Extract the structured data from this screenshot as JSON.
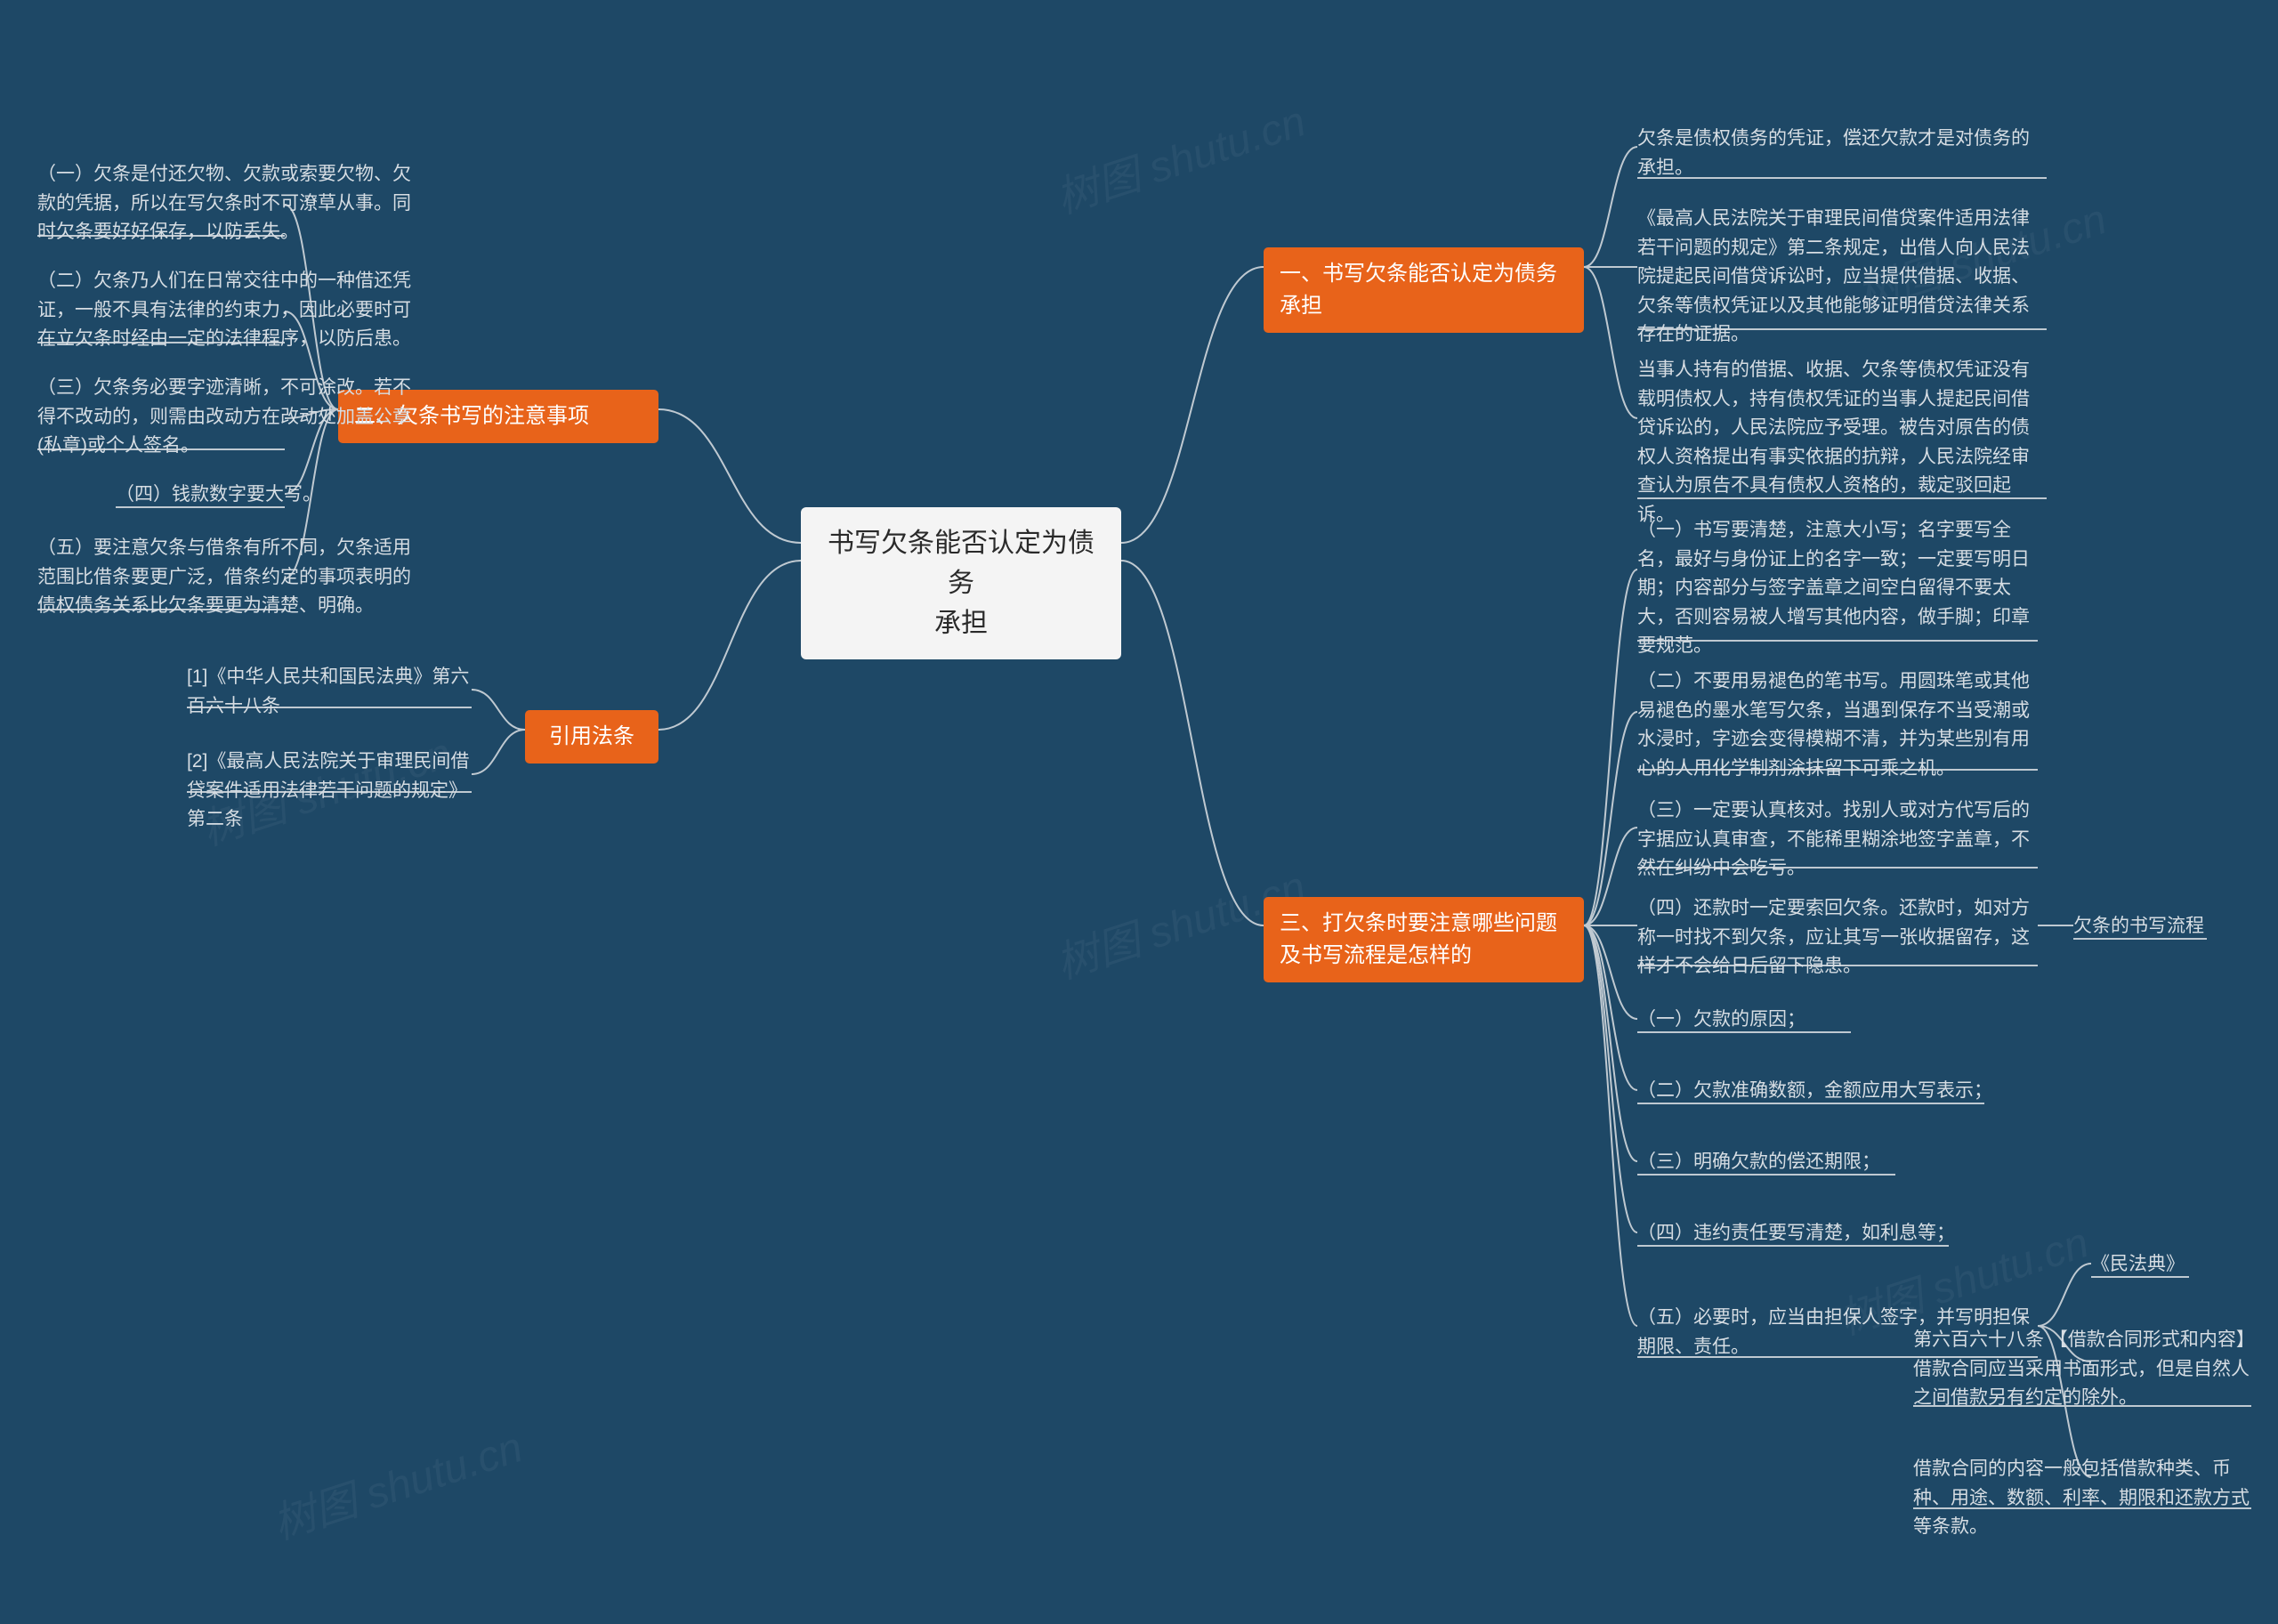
{
  "chart_data": {
    "type": "tree",
    "title": "书写欠条能否认定为债务承担",
    "branches": [
      {
        "side": "right",
        "label": "一、书写欠条能否认定为债务承担",
        "idx": 0
      },
      {
        "side": "right",
        "label": "三、打欠条时要注意哪些问题及书写流程是怎样的",
        "idx": 1
      },
      {
        "side": "left",
        "label": "二、欠条书写的注意事项",
        "idx": 2
      },
      {
        "side": "left",
        "label": "引用法条",
        "idx": 3
      }
    ]
  },
  "watermarks": {
    "text": "树图 shutu.cn"
  },
  "root": {
    "title_l1": "书写欠条能否认定为债务",
    "title_l2": "承担"
  },
  "right": {
    "s1": {
      "label": "一、书写欠条能否认定为债务承担",
      "leaves": {
        "l1": "欠条是债权债务的凭证，偿还欠款才是对债务的承担。",
        "l2": "《最高人民法院关于审理民间借贷案件适用法律若干问题的规定》第二条规定，出借人向人民法院提起民间借贷诉讼时，应当提供借据、收据、欠条等债权凭证以及其他能够证明借贷法律关系存在的证据。",
        "l3": "当事人持有的借据、收据、欠条等债权凭证没有载明债权人，持有债权凭证的当事人提起民间借贷诉讼的，人民法院应予受理。被告对原告的债权人资格提出有事实依据的抗辩，人民法院经审查认为原告不具有债权人资格的，裁定驳回起诉。"
      }
    },
    "s3": {
      "label": "三、打欠条时要注意哪些问题及书写流程是怎样的",
      "leaves": {
        "l1": "（一）书写要清楚，注意大小写；名字要写全名，最好与身份证上的名字一致；一定要写明日期；内容部分与签字盖章之间空白留得不要太大，否则容易被人增写其他内容，做手脚；印章要规范。",
        "l2": "（二）不要用易褪色的笔书写。用圆珠笔或其他易褪色的墨水笔写欠条，当遇到保存不当受潮或水浸时，字迹会变得模糊不清，并为某些别有用心的人用化学制剂涂抹留下可乘之机。",
        "l3": "（三）一定要认真核对。找别人或对方代写后的字据应认真审查，不能稀里糊涂地签字盖章，不然在纠纷中会吃亏。",
        "l4": "（四）还款时一定要索回欠条。还款时，如对方称一时找不到欠条，应让其写一张收据留存，这样才不会给日后留下隐患。",
        "l4_sub": "欠条的书写流程",
        "l5": "（一）欠款的原因；",
        "l6": "（二）欠款准确数额，金额应用大写表示；",
        "l7": "（三）明确欠款的偿还期限；",
        "l8": "（四）违约责任要写清楚，如利息等；",
        "l9": "（五）必要时，应当由担保人签字，并写明担保期限、责任。",
        "l9_sub1": "《民法典》",
        "l9_sub2": "第六百六十八条 【借款合同形式和内容】借款合同应当采用书面形式，但是自然人之间借款另有约定的除外。",
        "l9_sub3": "借款合同的内容一般包括借款种类、币种、用途、数额、利率、期限和还款方式等条款。"
      }
    }
  },
  "left": {
    "s2": {
      "label": "二、欠条书写的注意事项",
      "leaves": {
        "l1": "（一）欠条是付还欠物、欠款或索要欠物、欠款的凭据，所以在写欠条时不可潦草从事。同时欠条要好好保存，以防丢失。",
        "l2": "（二）欠条乃人们在日常交往中的一种借还凭证，一般不具有法律的约束力，因此必要时可在立欠条时经由一定的法律程序，以防后患。",
        "l3": "（三）欠条务必要字迹清晰，不可涂改。若不得不改动的，则需由改动方在改动处加盖公章(私章)或个人签名。",
        "l4": "（四）钱款数字要大写。",
        "l5": "（五）要注意欠条与借条有所不同，欠条适用范围比借条要更广泛，借条约定的事项表明的债权债务关系比欠条要更为清楚、明确。"
      }
    },
    "ref": {
      "label": "引用法条",
      "leaves": {
        "l1": "[1]《中华人民共和国民法典》第六百六十八条",
        "l2": "[2]《最高人民法院关于审理民间借贷案件适用法律若干问题的规定》第二条"
      }
    }
  }
}
